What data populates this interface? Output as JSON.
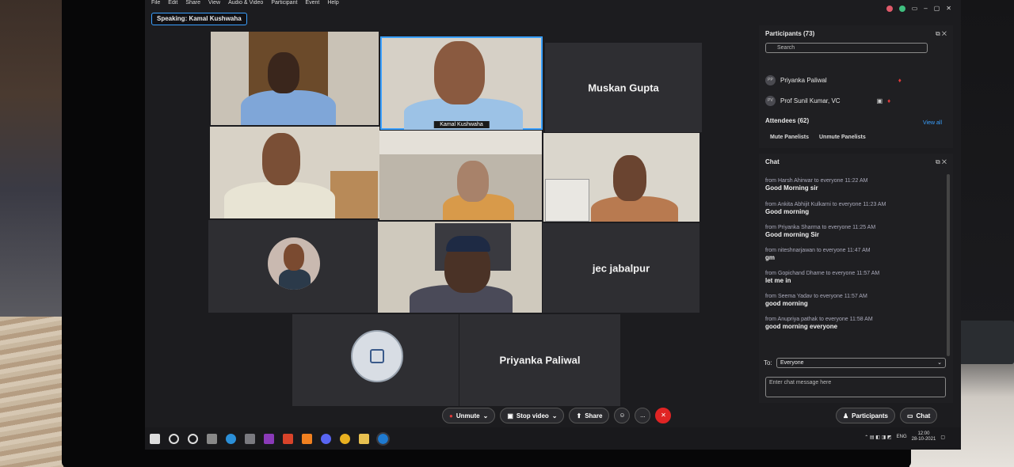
{
  "menu": [
    "File",
    "Edit",
    "Share",
    "View",
    "Audio & Video",
    "Participant",
    "Event",
    "Help"
  ],
  "speaking_label": "Speaking: Kamal Kushwaha",
  "tiles": {
    "active_speaker_tag": "Kamal Kushwaha",
    "muskan": "Muskan Gupta",
    "jec": "jec jabalpur",
    "priyanka": "Priyanka Paliwal"
  },
  "participants": {
    "header": "Participants (73)",
    "search_placeholder": "Search",
    "rows": [
      {
        "initials": "PP",
        "name": "Priyanka Paliwal"
      },
      {
        "initials": "PV",
        "name": "Prof Sunil Kumar, VC"
      }
    ],
    "attendees_header": "Attendees (62)",
    "view_all": "View all",
    "mute_panelists": "Mute Panelists",
    "unmute_panelists": "Unmute Panelists"
  },
  "chat": {
    "header": "Chat",
    "messages": [
      {
        "from": "from Harsh Ahirwar to everyone",
        "time": "11:22 AM",
        "text": "Good Morning sir"
      },
      {
        "from": "from Ankita Abhijit Kulkarni to everyone",
        "time": "11:23 AM",
        "text": "Good morning"
      },
      {
        "from": "from Priyanka Sharma to everyone",
        "time": "11:25 AM",
        "text": "Good morning Sir"
      },
      {
        "from": "from niteshnarjawan to everyone",
        "time": "11:47 AM",
        "text": "gm"
      },
      {
        "from": "from Gopichand Dharne to everyone",
        "time": "11:57 AM",
        "text": "let me in"
      },
      {
        "from": "from Seema Yadav to everyone",
        "time": "11:57 AM",
        "text": "good morning"
      },
      {
        "from": "from Anupriya pathak to everyone",
        "time": "11:58 AM",
        "text": "good morning everyone"
      }
    ],
    "to_label": "To:",
    "to_value": "Everyone",
    "input_placeholder": "Enter chat message here"
  },
  "toolbar": {
    "unmute": "Unmute",
    "stop_video": "Stop video",
    "share": "Share",
    "more": "...",
    "participants": "Participants",
    "chat": "Chat"
  },
  "tray": {
    "lang": "ENG",
    "time": "12:00",
    "date": "28-10-2021"
  },
  "colors": {
    "accent": "#3aa0ff",
    "end_call": "#e02424",
    "mute_red": "#e03a3a"
  }
}
